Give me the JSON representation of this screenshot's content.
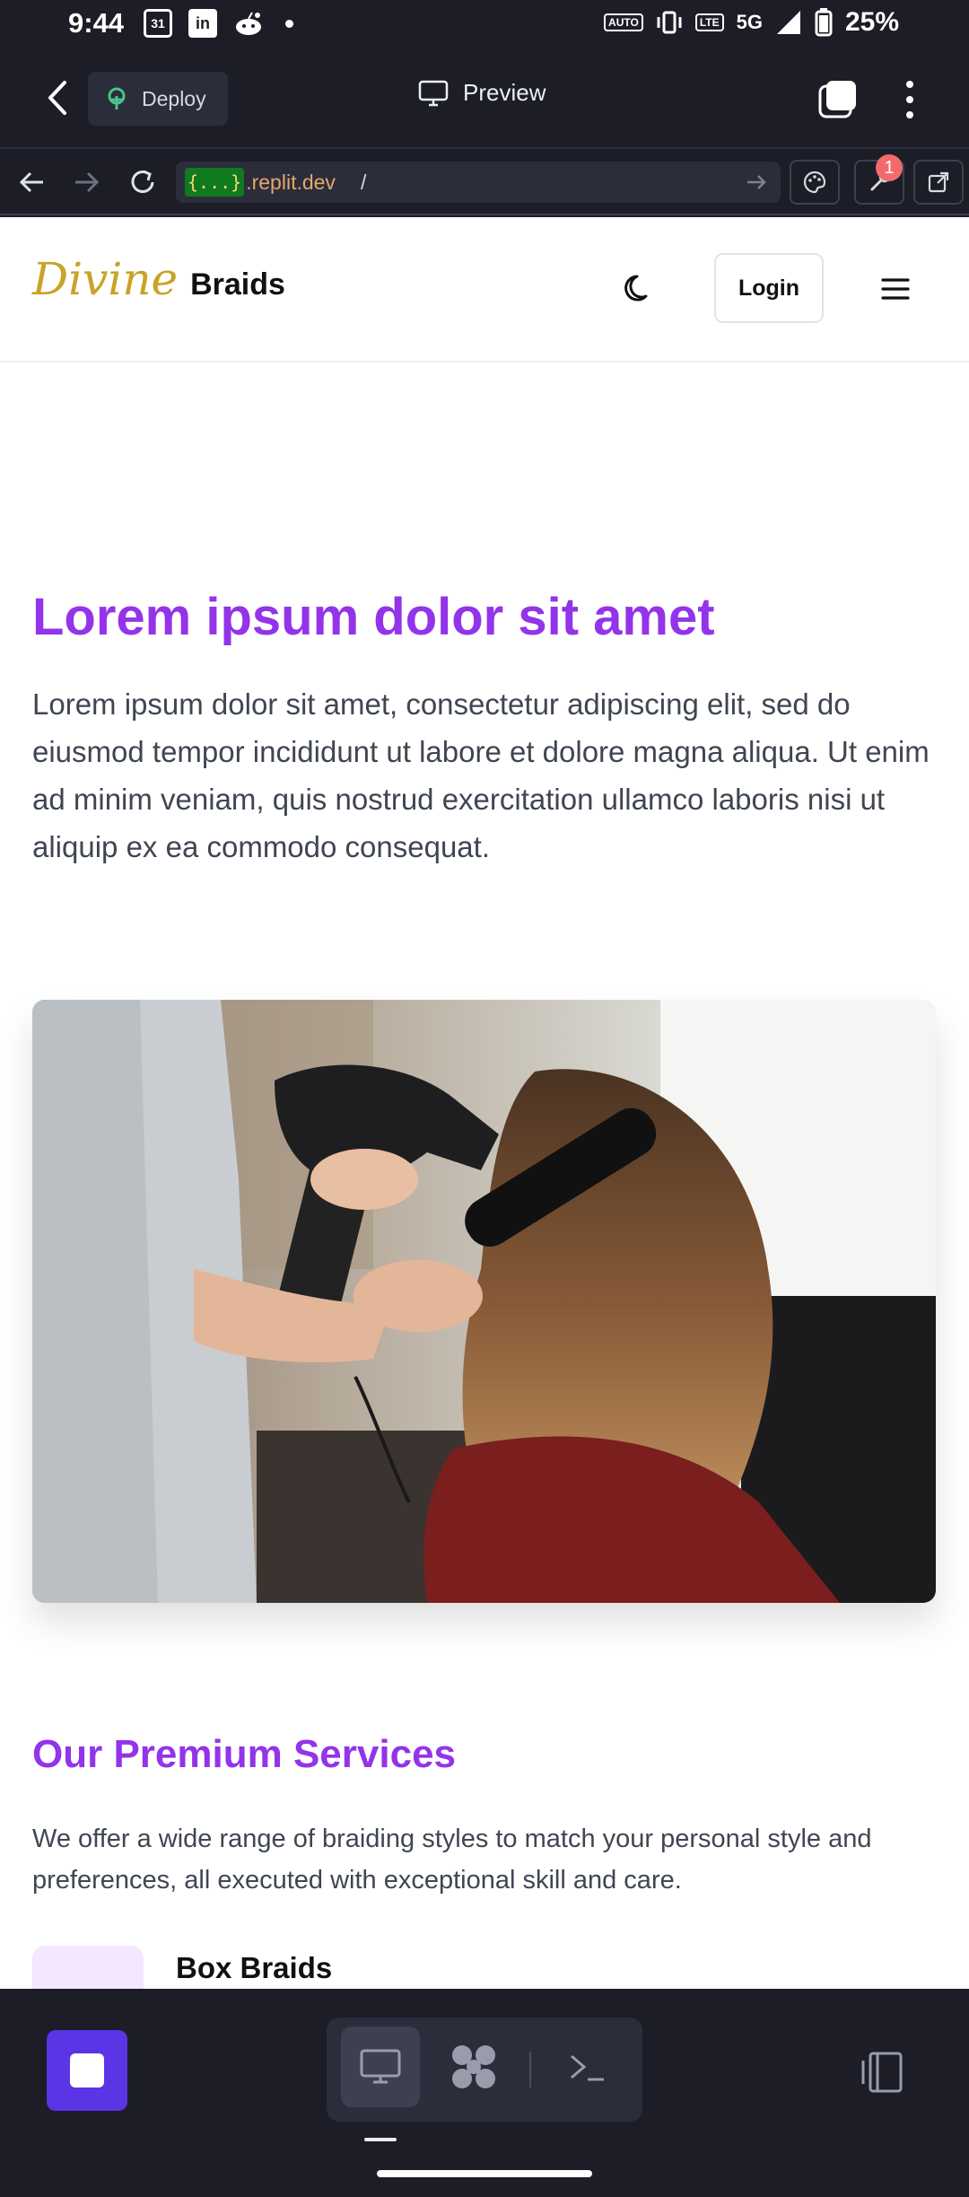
{
  "status_bar": {
    "time": "9:44",
    "calendar_day": "31",
    "linkedin": "in",
    "battery": "25%",
    "network": "5G",
    "auto_label": "AUTO",
    "volte_label": "LTE"
  },
  "replit": {
    "deploy_label": "Deploy",
    "preview_label": "Preview",
    "notification_count": "1",
    "url": {
      "badge": "{...}",
      "host": ".replit.dev",
      "path": "/"
    }
  },
  "site": {
    "logo_script": "Divine",
    "logo_word": "Braids",
    "login_label": "Login",
    "hero": {
      "title": "Lorem ipsum dolor sit amet",
      "text": "Lorem ipsum dolor sit amet, consectetur adipiscing elit, sed do eiusmod tempor incididunt ut labore et dolore magna aliqua. Ut enim ad minim veniam, quis nostrud exercitation ullamco laboris nisi ut aliquip ex ea commodo consequat."
    },
    "services": {
      "title": "Our Premium Services",
      "text": "We offer a wide range of braiding styles to match your personal style and preferences, all executed with exceptional skill and care.",
      "items": [
        {
          "name": "Box Braids"
        }
      ]
    }
  },
  "colors": {
    "accent": "#9333ea",
    "logo_gold": "#c9a227",
    "stop_button": "#5b34e6",
    "notification": "#f26a6a"
  },
  "icons": {
    "back": "chevron-left-icon",
    "deploy": "deploy-icon",
    "preview": "monitor-icon",
    "tabs": "tabs-icon",
    "menu": "kebab-menu-icon",
    "theme": "moon-icon",
    "site_menu": "hamburger-icon"
  }
}
